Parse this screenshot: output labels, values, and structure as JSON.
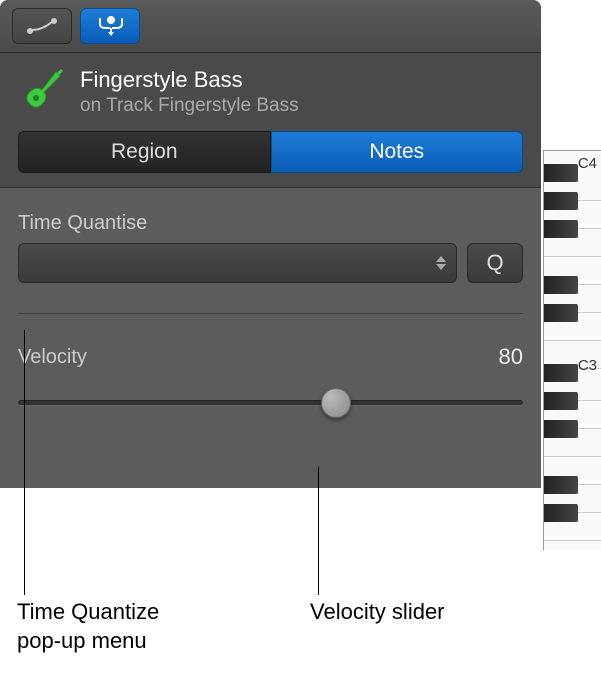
{
  "header": {
    "title": "Fingerstyle Bass",
    "subtitle": "on Track Fingerstyle Bass"
  },
  "tabs": {
    "region": "Region",
    "notes": "Notes"
  },
  "quantise": {
    "label": "Time Quantise",
    "button": "Q"
  },
  "velocity": {
    "label": "Velocity",
    "value": "80",
    "percent": 63
  },
  "piano": {
    "c4": "C4",
    "c3": "C3"
  },
  "callouts": {
    "quantise_menu": "Time Quantize pop-up menu",
    "velocity_slider": "Velocity slider"
  }
}
